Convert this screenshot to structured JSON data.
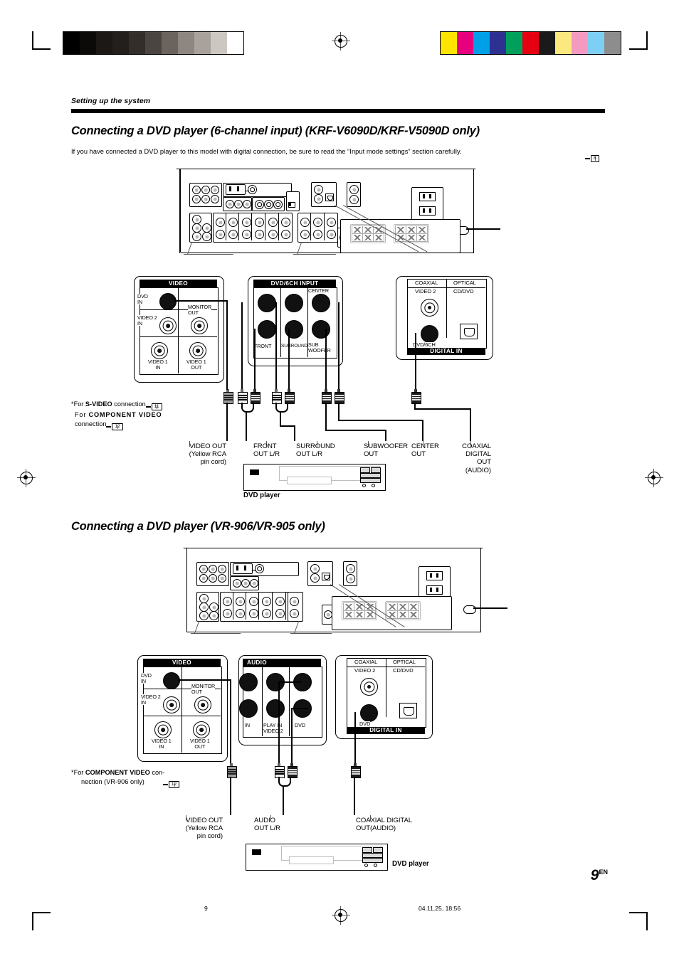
{
  "print_marks": {
    "gray_ramp": [
      "#000000",
      "#0c0a09",
      "#1b1815",
      "#221f1c",
      "#332e2a",
      "#4b4541",
      "#6a635e",
      "#8e8781",
      "#a9a29c",
      "#cdc7c2",
      "#ffffff"
    ],
    "color_bars": [
      "#ffe400",
      "#e6007e",
      "#00a0e9",
      "#2e3192",
      "#00a05a",
      "#e60012",
      "#1a1a1a",
      "#fbe87f",
      "#f49ac1",
      "#7dcff4",
      "#8d8d8d"
    ]
  },
  "breadcrumb": "Setting up the system",
  "section_one": {
    "heading": "Connecting a DVD player (6-channel input) (KRF-V6090D/KRF-V5090D only)",
    "intro": "If you have connected a DVD player to this model with digital connection, be sure to read the “Input mode settings” section carefully.",
    "intro_ref_page": "8",
    "video_panel": {
      "title": "VIDEO",
      "dvd_in": "DVD\nIN",
      "video2_in": "VIDEO 2\nIN",
      "monitor_out": "MONITOR\nOUT",
      "video1_in": "VIDEO 1\nIN",
      "video1_out": "VIDEO 1\nOUT"
    },
    "dvd6ch_panel": {
      "title": "DVD/6CH INPUT",
      "center": "CENTER",
      "front": "FRONT",
      "surround": "SURROUND",
      "subwoofer": "SUB\nWOOFER"
    },
    "digital_panel": {
      "coaxial": "COAXIAL",
      "optical": "OPTICAL",
      "video2": "VIDEO 2",
      "cd_dvd": "CD/DVD",
      "dvd6ch": "DVD/6CH",
      "title": "DIGITAL IN"
    },
    "footnote": {
      "line1_pre": "*For ",
      "line1_bold": "S-VIDEO",
      "line1_post": " connection",
      "line1_ref": "11",
      "line2_pre": "For ",
      "line2_bold": "COMPONENT VIDEO",
      "line3_pre": "connection",
      "line3_ref": "12"
    },
    "out_labels": [
      "VIDEO OUT\n(Yellow RCA\npin cord)",
      "FRONT\nOUT L/R",
      "SURROUND\nOUT L/R",
      "SUBWOOFER\nOUT",
      "CENTER\nOUT",
      "COAXIAL\nDIGITAL\nOUT\n(AUDIO)"
    ],
    "device_caption": "DVD player"
  },
  "section_two": {
    "heading": "Connecting a DVD player (VR-906/VR-905 only)",
    "video_panel": {
      "title": "VIDEO",
      "dvd_in": "DVD\nIN",
      "video2_in": "VIDEO 2\nIN",
      "monitor_out": "MONITOR\nOUT",
      "video1_in": "VIDEO 1\nIN",
      "video1_out": "VIDEO 1\nOUT"
    },
    "audio_panel": {
      "title": "AUDIO",
      "in": "IN",
      "play_in": "PLAY IN\nVIDEO 2",
      "dvd": "DVD"
    },
    "digital_panel": {
      "coaxial": "COAXIAL",
      "optical": "OPTICAL",
      "video2": "VIDEO 2",
      "cd_dvd": "CD/DVD",
      "dvd": "DVD",
      "title": "DIGITAL IN"
    },
    "footnote": {
      "line1_pre": "*For ",
      "line1_bold": "COMPONENT VIDEO",
      "line1_post": " con-",
      "line2": "nection (VR-906 only)",
      "line2_ref": "12"
    },
    "out_labels": [
      "VIDEO OUT\n(Yellow RCA\npin cord)",
      "AUDIO\nOUT L/R",
      "COAXIAL DIGITAL\nOUT(AUDIO)"
    ],
    "device_caption": "DVD player"
  },
  "page_number": "9",
  "page_suffix": "EN",
  "footer": {
    "left": "9",
    "right": "04.11.25, 18:56"
  }
}
